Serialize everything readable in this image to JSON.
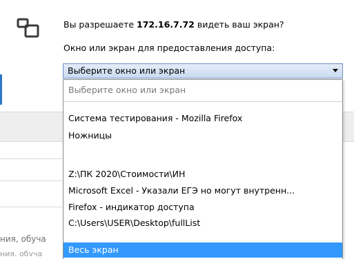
{
  "dialog": {
    "question_prefix": "Вы разрешаете",
    "host": "172.16.7.72",
    "question_suffix": "видеть ваш экран?",
    "prompt_label": "Окно или экран для предоставления доступа:",
    "select": {
      "value": "Выберите окно или экран"
    },
    "dropdown": {
      "placeholder": "Выберите окно или экран",
      "items": [
        "Система тестирования - Mozilla Firefox",
        "Ножницы",
        "Z:\\ПК 2020\\Стоимости\\ИН",
        "Microsoft Excel - Указали ЕГЭ но могут внутренн...",
        "Firefox - индикатор доступа",
        "C:\\Users\\USER\\Desktop\\fullList",
        "Весь экран"
      ],
      "selected_index": 6
    }
  },
  "background": {
    "partial_text": "ния, обуча"
  },
  "colors": {
    "highlight": "#3399ff",
    "accent": "#2c78c6"
  },
  "icons": {
    "share": "screen-share-icon"
  }
}
